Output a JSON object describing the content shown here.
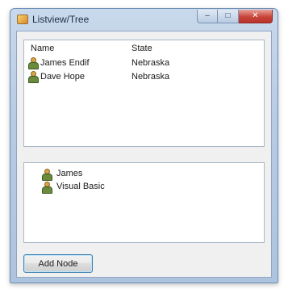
{
  "window": {
    "title": "Listview/Tree",
    "caption_buttons": {
      "minimize": "–",
      "maximize": "□",
      "close": "✕"
    }
  },
  "listview": {
    "columns": [
      "Name",
      "State"
    ],
    "rows": [
      {
        "name": "James Endif",
        "state": "Nebraska",
        "icon": "person-icon"
      },
      {
        "name": "Dave Hope",
        "state": "Nebraska",
        "icon": "person-icon"
      }
    ]
  },
  "treeview": {
    "nodes": [
      {
        "label": "James",
        "icon": "person-icon"
      },
      {
        "label": "Visual Basic",
        "icon": "person-icon"
      }
    ]
  },
  "buttons": {
    "add_node": "Add Node"
  },
  "colors": {
    "accent": "#3c7fb1",
    "close_button": "#c9453a",
    "frame": "#b7cbe3"
  }
}
